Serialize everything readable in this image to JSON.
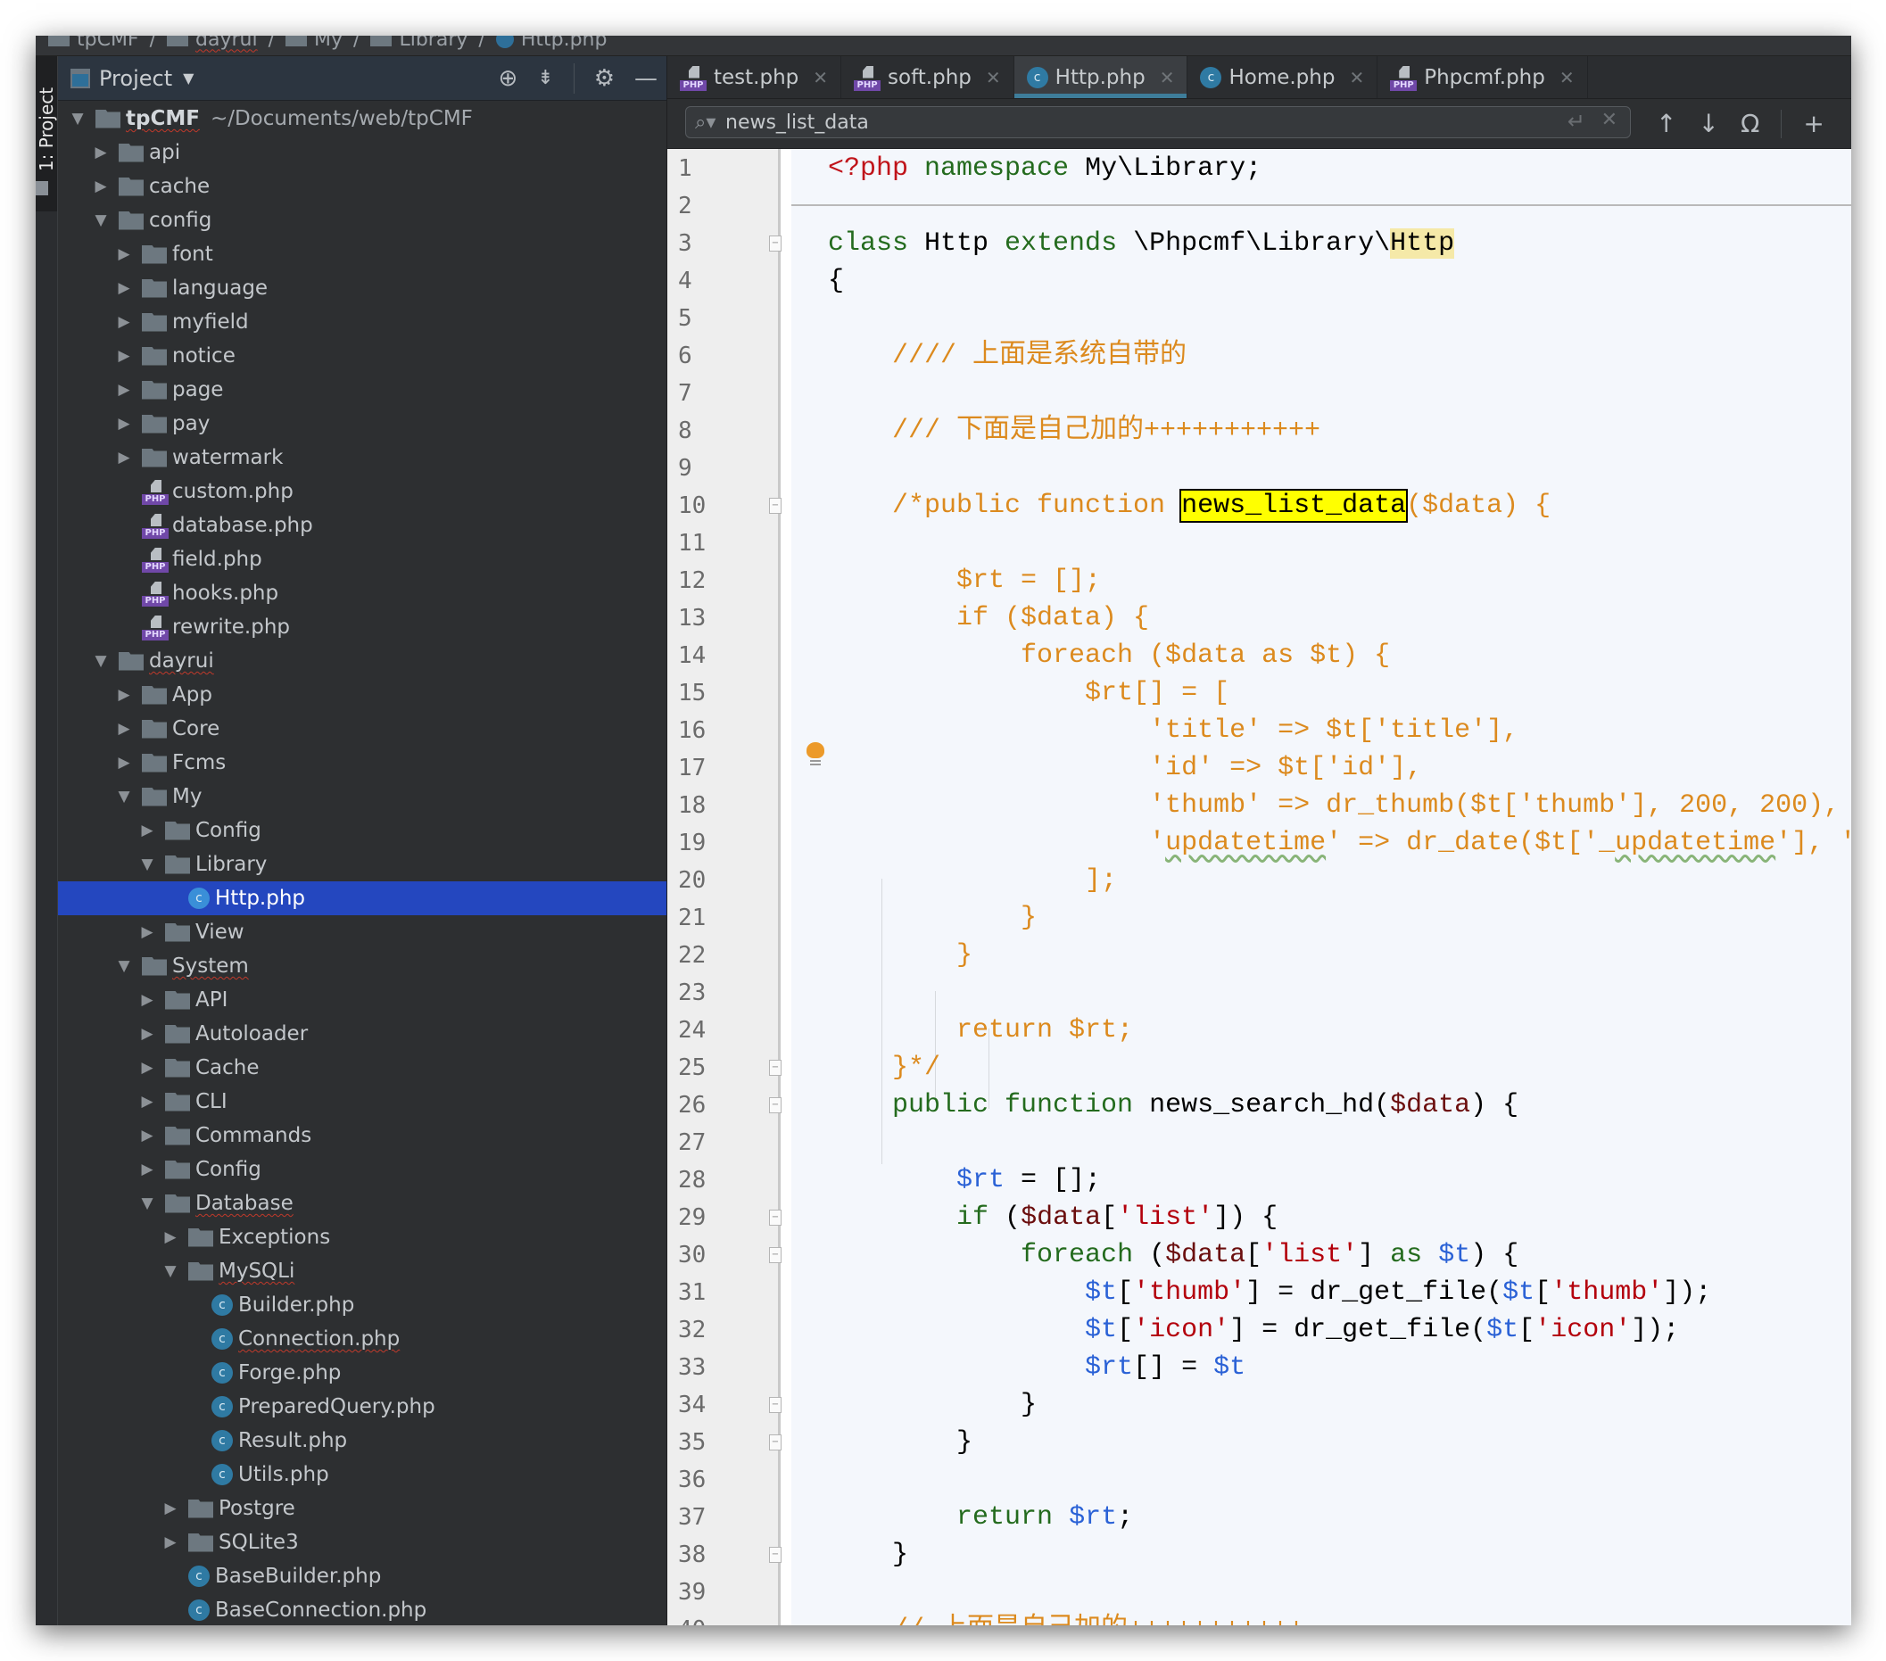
{
  "breadcrumb": [
    "tpCMF",
    "dayrui",
    "My",
    "Library",
    "Http.php"
  ],
  "tool_strip": {
    "label": "1: Project"
  },
  "project_panel": {
    "title": "Project",
    "tools": [
      "locate-icon",
      "collapse-all-icon",
      "gear-icon",
      "minimize-icon"
    ],
    "root": {
      "name": "tpCMF",
      "path": "~/Documents/web/tpCMF"
    },
    "tree": [
      {
        "name": "api",
        "type": "folder",
        "depth": 1,
        "state": "collapsed"
      },
      {
        "name": "cache",
        "type": "folder",
        "depth": 1,
        "state": "collapsed"
      },
      {
        "name": "config",
        "type": "folder",
        "depth": 1,
        "state": "expanded"
      },
      {
        "name": "font",
        "type": "folder",
        "depth": 2,
        "state": "collapsed"
      },
      {
        "name": "language",
        "type": "folder",
        "depth": 2,
        "state": "collapsed"
      },
      {
        "name": "myfield",
        "type": "folder",
        "depth": 2,
        "state": "collapsed"
      },
      {
        "name": "notice",
        "type": "folder",
        "depth": 2,
        "state": "collapsed"
      },
      {
        "name": "page",
        "type": "folder",
        "depth": 2,
        "state": "collapsed"
      },
      {
        "name": "pay",
        "type": "folder",
        "depth": 2,
        "state": "collapsed"
      },
      {
        "name": "watermark",
        "type": "folder",
        "depth": 2,
        "state": "collapsed"
      },
      {
        "name": "custom.php",
        "type": "php",
        "depth": 2
      },
      {
        "name": "database.php",
        "type": "php",
        "depth": 2
      },
      {
        "name": "field.php",
        "type": "php",
        "depth": 2
      },
      {
        "name": "hooks.php",
        "type": "php",
        "depth": 2
      },
      {
        "name": "rewrite.php",
        "type": "php",
        "depth": 2
      },
      {
        "name": "dayrui",
        "type": "folder",
        "depth": 1,
        "state": "expanded",
        "squiggle": true
      },
      {
        "name": "App",
        "type": "folder",
        "depth": 2,
        "state": "collapsed"
      },
      {
        "name": "Core",
        "type": "folder",
        "depth": 2,
        "state": "collapsed"
      },
      {
        "name": "Fcms",
        "type": "folder",
        "depth": 2,
        "state": "collapsed"
      },
      {
        "name": "My",
        "type": "folder",
        "depth": 2,
        "state": "expanded"
      },
      {
        "name": "Config",
        "type": "folder",
        "depth": 3,
        "state": "collapsed"
      },
      {
        "name": "Library",
        "type": "folder",
        "depth": 3,
        "state": "expanded"
      },
      {
        "name": "Http.php",
        "type": "class",
        "depth": 4,
        "selected": true
      },
      {
        "name": "View",
        "type": "folder",
        "depth": 3,
        "state": "collapsed"
      },
      {
        "name": "System",
        "type": "folder",
        "depth": 2,
        "state": "expanded",
        "squiggle": true
      },
      {
        "name": "API",
        "type": "folder",
        "depth": 3,
        "state": "collapsed"
      },
      {
        "name": "Autoloader",
        "type": "folder",
        "depth": 3,
        "state": "collapsed"
      },
      {
        "name": "Cache",
        "type": "folder",
        "depth": 3,
        "state": "collapsed"
      },
      {
        "name": "CLI",
        "type": "folder",
        "depth": 3,
        "state": "collapsed"
      },
      {
        "name": "Commands",
        "type": "folder",
        "depth": 3,
        "state": "collapsed"
      },
      {
        "name": "Config",
        "type": "folder",
        "depth": 3,
        "state": "collapsed"
      },
      {
        "name": "Database",
        "type": "folder",
        "depth": 3,
        "state": "expanded",
        "squiggle": true
      },
      {
        "name": "Exceptions",
        "type": "folder",
        "depth": 4,
        "state": "collapsed"
      },
      {
        "name": "MySQLi",
        "type": "folder",
        "depth": 4,
        "state": "expanded",
        "squiggle": true
      },
      {
        "name": "Builder.php",
        "type": "class",
        "depth": 5
      },
      {
        "name": "Connection.php",
        "type": "class",
        "depth": 5,
        "squiggle": true
      },
      {
        "name": "Forge.php",
        "type": "class",
        "depth": 5
      },
      {
        "name": "PreparedQuery.php",
        "type": "class",
        "depth": 5
      },
      {
        "name": "Result.php",
        "type": "class",
        "depth": 5
      },
      {
        "name": "Utils.php",
        "type": "class",
        "depth": 5
      },
      {
        "name": "Postgre",
        "type": "folder",
        "depth": 4,
        "state": "collapsed"
      },
      {
        "name": "SQLite3",
        "type": "folder",
        "depth": 4,
        "state": "collapsed"
      },
      {
        "name": "BaseBuilder.php",
        "type": "class",
        "depth": 4
      },
      {
        "name": "BaseConnection.php",
        "type": "class",
        "depth": 4,
        "abstract": true
      }
    ]
  },
  "tabs": [
    {
      "label": "test.php",
      "icon": "php",
      "active": false
    },
    {
      "label": "soft.php",
      "icon": "php",
      "active": false
    },
    {
      "label": "Http.php",
      "icon": "class",
      "active": true
    },
    {
      "label": "Home.php",
      "icon": "class",
      "active": false
    },
    {
      "label": "Phpcmf.php",
      "icon": "php",
      "active": false
    }
  ],
  "find": {
    "query": "news_list_data",
    "tools": [
      "previous-occurrence-icon",
      "next-occurrence-icon",
      "select-all-occurrences-icon",
      "add-selection-icon"
    ]
  },
  "editor": {
    "fold_markers": [
      3,
      10,
      25,
      26,
      29,
      30,
      34,
      35,
      38
    ],
    "bulb_line": 17,
    "lines": [
      [
        [
          "tag",
          "<?php "
        ],
        [
          "k",
          "namespace "
        ],
        [
          "",
          "My\\Library;"
        ]
      ],
      [],
      [
        [
          "k",
          "class "
        ],
        [
          "",
          "Http "
        ],
        [
          "k",
          "extends "
        ],
        [
          "",
          "\\Phpcmf\\Library\\"
        ],
        [
          "hl2",
          "Http"
        ]
      ],
      [
        [
          "",
          "{"
        ]
      ],
      [],
      [
        [
          "cm",
          "    //// 上面是系统自带的"
        ]
      ],
      [],
      [
        [
          "cm",
          "    /// 下面是自己加的+++++++++++"
        ]
      ],
      [],
      [
        [
          "cm",
          "    /*public function "
        ],
        [
          "hl",
          "news_list_data"
        ],
        [
          "cm",
          "($data) {"
        ]
      ],
      [],
      [
        [
          "cm",
          "        $rt = [];"
        ]
      ],
      [
        [
          "cm",
          "        if ($data) {"
        ]
      ],
      [
        [
          "cm",
          "            foreach ($data as $t) {"
        ]
      ],
      [
        [
          "cm",
          "                $rt[] = ["
        ]
      ],
      [
        [
          "cm",
          "                    'title' => $t['title'],"
        ]
      ],
      [
        [
          "cm",
          "                    'id' => $t['id'],"
        ]
      ],
      [
        [
          "cm",
          "                    'thumb' => dr_thumb($t['thumb'], 200, 200),"
        ]
      ],
      [
        [
          "cm",
          "                    '"
        ],
        [
          "cmw",
          "updatetime"
        ],
        [
          "cm",
          "' => dr_date($t['_"
        ],
        [
          "cmw",
          "updatetime"
        ],
        [
          "cm",
          "'], 'Y-m-d'),"
        ]
      ],
      [
        [
          "cm",
          "                ];"
        ]
      ],
      [
        [
          "cm",
          "            }"
        ]
      ],
      [
        [
          "cm",
          "        }"
        ]
      ],
      [],
      [
        [
          "cm",
          "        return $rt;"
        ]
      ],
      [
        [
          "cm",
          "    }*/"
        ]
      ],
      [
        [
          "",
          "    "
        ],
        [
          "k",
          "public function "
        ],
        [
          "",
          "news_search_hd("
        ],
        [
          "p",
          "$data"
        ],
        [
          "",
          ") {"
        ]
      ],
      [],
      [
        [
          "",
          "        "
        ],
        [
          "v",
          "$rt"
        ],
        [
          "",
          " = [];"
        ]
      ],
      [
        [
          "",
          "        "
        ],
        [
          "k",
          "if "
        ],
        [
          "",
          "("
        ],
        [
          "p",
          "$data"
        ],
        [
          "",
          "["
        ],
        [
          "s",
          "'list'"
        ],
        [
          "",
          "]) {"
        ]
      ],
      [
        [
          "",
          "            "
        ],
        [
          "k",
          "foreach "
        ],
        [
          "",
          "("
        ],
        [
          "p",
          "$data"
        ],
        [
          "",
          "["
        ],
        [
          "s",
          "'list'"
        ],
        [
          "",
          "] "
        ],
        [
          "k",
          "as "
        ],
        [
          "v",
          "$t"
        ],
        [
          "",
          ") {"
        ]
      ],
      [
        [
          "",
          "                "
        ],
        [
          "v",
          "$t"
        ],
        [
          "",
          "["
        ],
        [
          "s",
          "'thumb'"
        ],
        [
          "",
          "] = dr_get_file("
        ],
        [
          "v",
          "$t"
        ],
        [
          "",
          "["
        ],
        [
          "s",
          "'thumb'"
        ],
        [
          "",
          "]);"
        ]
      ],
      [
        [
          "",
          "                "
        ],
        [
          "v",
          "$t"
        ],
        [
          "",
          "["
        ],
        [
          "s",
          "'icon'"
        ],
        [
          "",
          "] = dr_get_file("
        ],
        [
          "v",
          "$t"
        ],
        [
          "",
          "["
        ],
        [
          "s",
          "'icon'"
        ],
        [
          "",
          "]);"
        ]
      ],
      [
        [
          "",
          "                "
        ],
        [
          "v",
          "$rt"
        ],
        [
          "",
          "[] = "
        ],
        [
          "v",
          "$t"
        ],
        [
          ";"
        ]
      ],
      [
        [
          "",
          "            }"
        ]
      ],
      [
        [
          "",
          "        }"
        ]
      ],
      [],
      [
        [
          "",
          "        "
        ],
        [
          "k",
          "return "
        ],
        [
          "v",
          "$rt"
        ],
        [
          "",
          ";"
        ]
      ],
      [
        [
          "",
          "    }"
        ]
      ],
      [],
      [
        [
          "cm",
          "    // 上面是自己加的+++++++++++"
        ]
      ]
    ]
  }
}
